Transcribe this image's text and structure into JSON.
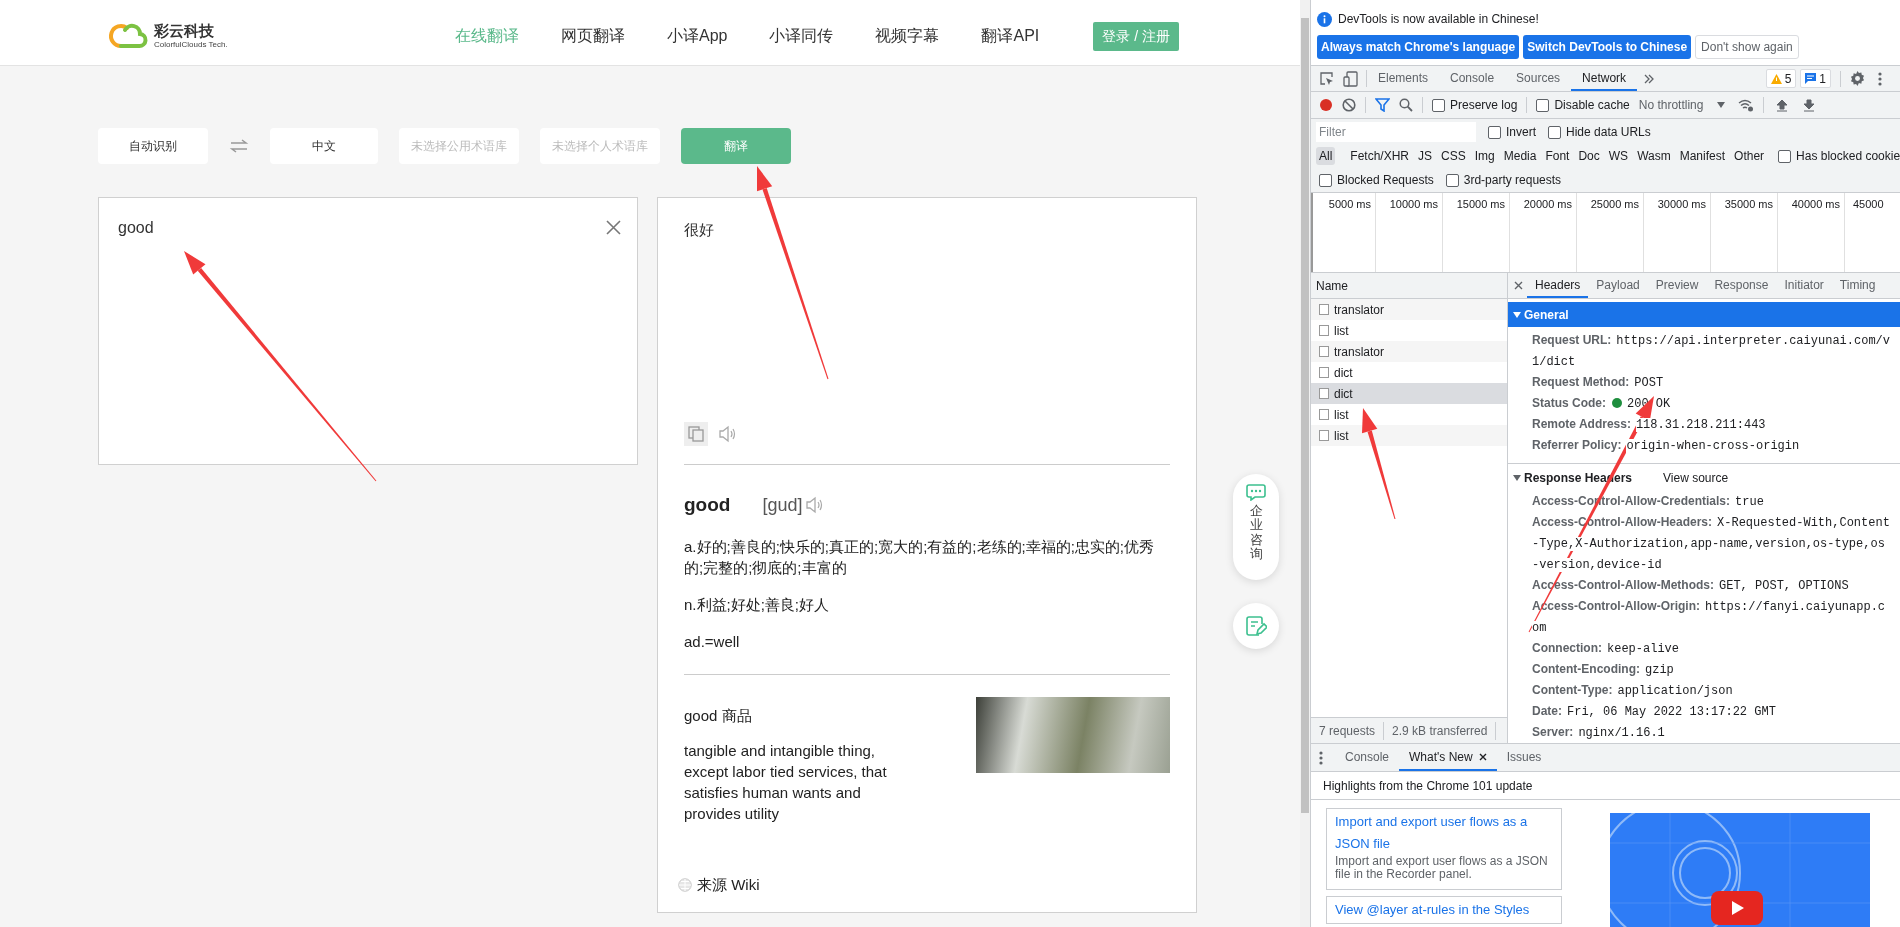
{
  "site": {
    "logo_title": "彩云科技",
    "logo_subtitle": "ColorfulClouds Tech.",
    "nav": [
      {
        "label": "在线翻译",
        "selected": true
      },
      {
        "label": "网页翻译",
        "selected": false
      },
      {
        "label": "小译App",
        "selected": false
      },
      {
        "label": "小译同传",
        "selected": false
      },
      {
        "label": "视频字幕",
        "selected": false
      },
      {
        "label": "翻译API",
        "selected": false
      }
    ],
    "login": "登录 / 注册"
  },
  "translator": {
    "source_language": "自动识别",
    "target_language": "中文",
    "glossaries": [
      "未选择公用术语库",
      "未选择个人术语库"
    ],
    "translate_button": "翻译",
    "input": {
      "value": "good"
    },
    "output": {
      "translation": "很好",
      "word": "good",
      "phonetic": "[gud]",
      "definitions": [
        "a.好的;善良的;快乐的;真正的;宽大的;有益的;老练的;幸福的;忠实的;优秀的;完整的;彻底的;丰富的",
        "n.利益;好处;善良;好人",
        "ad.=well"
      ],
      "wiki": {
        "title": "good 商品",
        "text": "tangible and intangible thing, except labor tied services, that satisfies human wants and provides utility",
        "source": "来源 Wiki"
      }
    }
  },
  "floating": {
    "consult": "企业咨询"
  },
  "devtools": {
    "infobar": {
      "message": "DevTools is now available in Chinese!",
      "buttons": [
        {
          "label": "Always match Chrome's language",
          "kind": "primary"
        },
        {
          "label": "Switch DevTools to Chinese",
          "kind": "primary"
        },
        {
          "label": "Don't show again",
          "kind": "secondary"
        }
      ]
    },
    "tabs": [
      {
        "label": "Elements",
        "selected": false
      },
      {
        "label": "Console",
        "selected": false
      },
      {
        "label": "Sources",
        "selected": false
      },
      {
        "label": "Network",
        "selected": true
      }
    ],
    "warnings": "5",
    "messages": "1",
    "toolbar": {
      "recording": true,
      "preserve_log": {
        "label": "Preserve log",
        "checked": false
      },
      "disable_cache": {
        "label": "Disable cache",
        "checked": false
      },
      "throttling": "No throttling"
    },
    "filter": {
      "placeholder": "Filter",
      "invert": {
        "label": "Invert",
        "checked": false
      },
      "hide_data_urls": {
        "label": "Hide data URLs",
        "checked": false
      }
    },
    "types": [
      {
        "label": "All",
        "selected": true
      },
      {
        "label": "Fetch/XHR",
        "selected": false
      },
      {
        "label": "JS",
        "selected": false
      },
      {
        "label": "CSS",
        "selected": false
      },
      {
        "label": "Img",
        "selected": false
      },
      {
        "label": "Media",
        "selected": false
      },
      {
        "label": "Font",
        "selected": false
      },
      {
        "label": "Doc",
        "selected": false
      },
      {
        "label": "WS",
        "selected": false
      },
      {
        "label": "Wasm",
        "selected": false
      },
      {
        "label": "Manifest",
        "selected": false
      },
      {
        "label": "Other",
        "selected": false
      }
    ],
    "has_blocked_cookies": {
      "label": "Has blocked cookie",
      "checked": false
    },
    "blocked_requests": {
      "label": "Blocked Requests",
      "checked": false
    },
    "third_party": {
      "label": "3rd-party requests",
      "checked": false
    },
    "timeline_ticks": [
      "5000 ms",
      "10000 ms",
      "15000 ms",
      "20000 ms",
      "25000 ms",
      "30000 ms",
      "35000 ms",
      "40000 ms",
      "45000"
    ],
    "requests": {
      "column": "Name",
      "rows": [
        {
          "name": "translator",
          "selected": false
        },
        {
          "name": "list",
          "selected": false
        },
        {
          "name": "translator",
          "selected": false
        },
        {
          "name": "dict",
          "selected": false
        },
        {
          "name": "dict",
          "selected": true
        },
        {
          "name": "list",
          "selected": false
        },
        {
          "name": "list",
          "selected": false
        }
      ],
      "count": "7 requests",
      "transferred": "2.9 kB transferred"
    },
    "detail_tabs": [
      {
        "label": "Headers",
        "selected": true
      },
      {
        "label": "Payload",
        "selected": false
      },
      {
        "label": "Preview",
        "selected": false
      },
      {
        "label": "Response",
        "selected": false
      },
      {
        "label": "Initiator",
        "selected": false
      },
      {
        "label": "Timing",
        "selected": false
      }
    ],
    "general": {
      "title": "General",
      "expanded": true,
      "fields": [
        {
          "name": "Request URL:",
          "value": "https://api.interpreter.caiyunai.com/v1/dict"
        },
        {
          "name": "Request Method:",
          "value": "POST"
        },
        {
          "name": "Status Code:",
          "value": "200 OK",
          "color": "#1e8e3e"
        },
        {
          "name": "Remote Address:",
          "value": "118.31.218.211:443"
        },
        {
          "name": "Referrer Policy:",
          "value": "origin-when-cross-origin"
        }
      ]
    },
    "response_headers": {
      "title": "Response Headers",
      "expanded": true,
      "view_source": "View source",
      "fields": [
        {
          "name": "Access-Control-Allow-Credentials:",
          "value": "true"
        },
        {
          "name": "Access-Control-Allow-Headers:",
          "value": "X-Requested-With,Content-Type,X-Authorization,app-name,version,os-type,os-version,device-id"
        },
        {
          "name": "Access-Control-Allow-Methods:",
          "value": "GET, POST, OPTIONS"
        },
        {
          "name": "Access-Control-Allow-Origin:",
          "value": "https://fanyi.caiyunapp.com"
        },
        {
          "name": "Connection:",
          "value": "keep-alive"
        },
        {
          "name": "Content-Encoding:",
          "value": "gzip"
        },
        {
          "name": "Content-Type:",
          "value": "application/json"
        },
        {
          "name": "Date:",
          "value": "Fri, 06 May 2022 13:17:22 GMT"
        },
        {
          "name": "Server:",
          "value": "nginx/1.16.1"
        }
      ]
    },
    "drawer": {
      "tabs": [
        {
          "label": "Console",
          "selected": false,
          "closable": false
        },
        {
          "label": "What's New",
          "selected": true,
          "closable": true
        },
        {
          "label": "Issues",
          "selected": false,
          "closable": false
        }
      ],
      "headline": "Highlights from the Chrome 101 update",
      "cards": [
        {
          "title": "Import and export user flows as a JSON file",
          "text": "Import and export user flows as a JSON file in the Recorder panel."
        },
        {
          "title": "View @layer at-rules in the Styles"
        }
      ]
    }
  }
}
